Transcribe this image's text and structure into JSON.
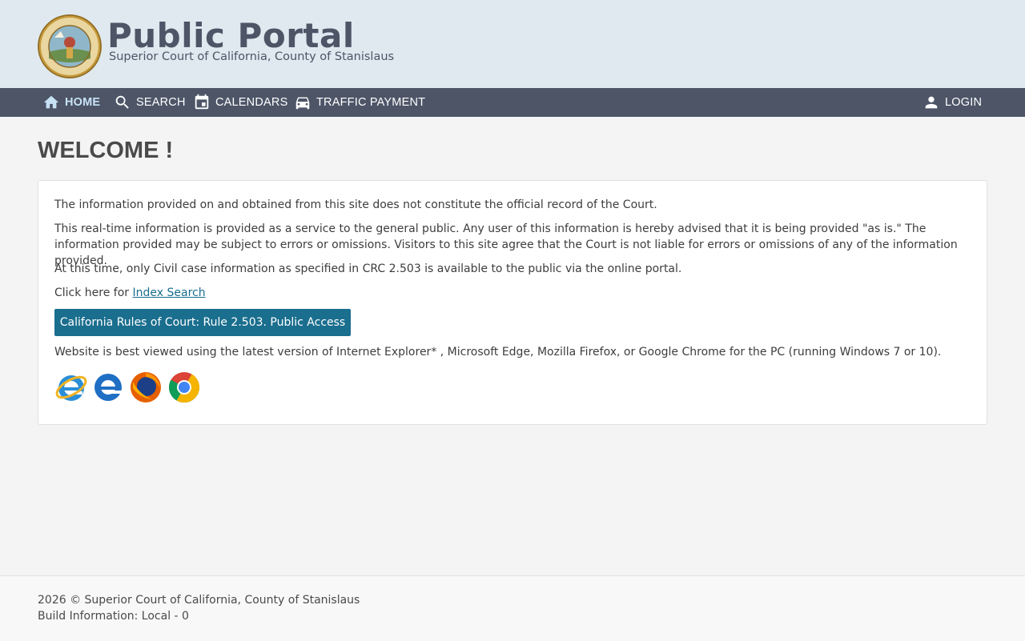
{
  "header": {
    "title": "Public Portal",
    "subtitle": "Superior Court of California, County of Stanislaus",
    "seal_icon": "county-seal-icon"
  },
  "nav": {
    "items": [
      {
        "label": "HOME",
        "icon": "home-icon",
        "active": true
      },
      {
        "label": "SEARCH",
        "icon": "search-icon",
        "active": false
      },
      {
        "label": "CALENDARS",
        "icon": "calendar-icon",
        "active": false
      },
      {
        "label": "TRAFFIC PAYMENT",
        "icon": "car-icon",
        "active": false
      }
    ],
    "login": {
      "label": "LOGIN",
      "icon": "user-icon"
    }
  },
  "main": {
    "title": "WELCOME !",
    "paragraphs": [
      "The information provided on and obtained from this site does not constitute the official record of the Court.",
      "This real-time information is provided as a service to the general public. Any user of this information is hereby advised that it is being provided \"as is.\" The information provided may be subject to errors or omissions. Visitors to this site agree that the Court is not liable for errors or omissions of any of the information provided.",
      "At this time, only Civil case information as specified in CRC 2.503 is available to the public via the online portal."
    ],
    "click_prefix": "Click here for ",
    "index_search_link": "Index Search",
    "rules_button": "California Rules of Court: Rule 2.503. Public Access",
    "browser_note": "Website is best viewed using the latest version of Internet Explorer* , Microsoft Edge, Mozilla Firefox, or Google Chrome for the PC (running Windows 7 or 10).",
    "browsers": [
      "internet-explorer-icon",
      "edge-icon",
      "firefox-icon",
      "chrome-icon"
    ]
  },
  "footer": {
    "copyright": "2026 © Superior Court of California, County of Stanislaus",
    "build": "Build Information: Local - 0"
  },
  "colors": {
    "header_bg": "#dfe9ef",
    "nav_bg": "#4d5567",
    "accent": "#1a6e8e",
    "active_nav": "#c7e1f5"
  }
}
